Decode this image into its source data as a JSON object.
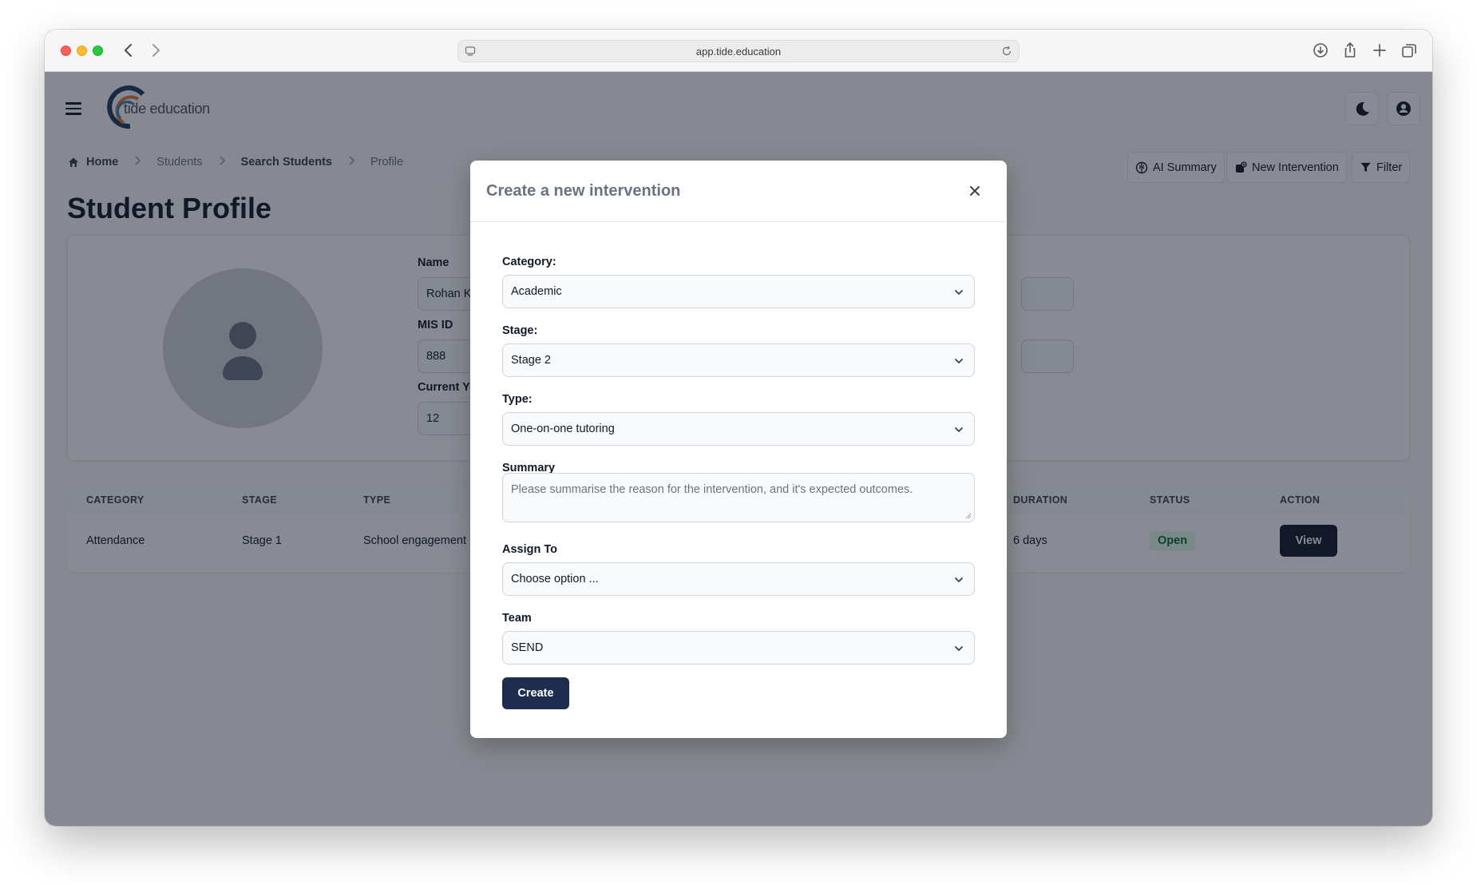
{
  "browser": {
    "url": "app.tide.education"
  },
  "header": {
    "brand": "tide education"
  },
  "breadcrumbs": [
    "Home",
    "Students",
    "Search Students",
    "Profile"
  ],
  "actions": {
    "ai_summary": "AI Summary",
    "new_intervention": "New Intervention",
    "filter": "Filter"
  },
  "page": {
    "title": "Student Profile"
  },
  "profile": {
    "name_label": "Name",
    "name_value": "Rohan Ke",
    "mis_label": "MIS ID",
    "mis_value": "888",
    "year_label": "Current Ye",
    "year_value": "12"
  },
  "table": {
    "headers": [
      "CATEGORY",
      "STAGE",
      "TYPE",
      "DURATION",
      "STATUS",
      "ACTION"
    ],
    "row": {
      "category": "Attendance",
      "stage": "Stage 1",
      "type": "School engagement",
      "duration": "6 days",
      "status": "Open",
      "action": "View"
    }
  },
  "modal": {
    "title": "Create a new intervention",
    "category_label": "Category:",
    "category_value": "Academic",
    "stage_label": "Stage:",
    "stage_value": "Stage 2",
    "type_label": "Type:",
    "type_value": "One-on-one tutoring",
    "summary_label": "Summary",
    "summary_placeholder": "Please summarise the reason for the intervention, and it's expected outcomes.",
    "assign_label": "Assign To",
    "assign_value": "Choose option ...",
    "team_label": "Team",
    "team_value": "SEND",
    "create_label": "Create"
  },
  "colors": {
    "overlay": "#111827",
    "primary_button": "#1e2d4d",
    "status_open_bg": "#dcfce7",
    "status_open_text": "#166534"
  },
  "icons": [
    "back-icon",
    "forward-icon",
    "reader-icon",
    "reload-icon",
    "download-icon",
    "share-icon",
    "new-tab-icon",
    "tabs-overview-icon",
    "hamburger-icon",
    "moon-icon",
    "user-icon",
    "home-icon",
    "brain-icon",
    "intervention-icon",
    "filter-icon",
    "close-icon",
    "chevron-down-icon"
  ]
}
